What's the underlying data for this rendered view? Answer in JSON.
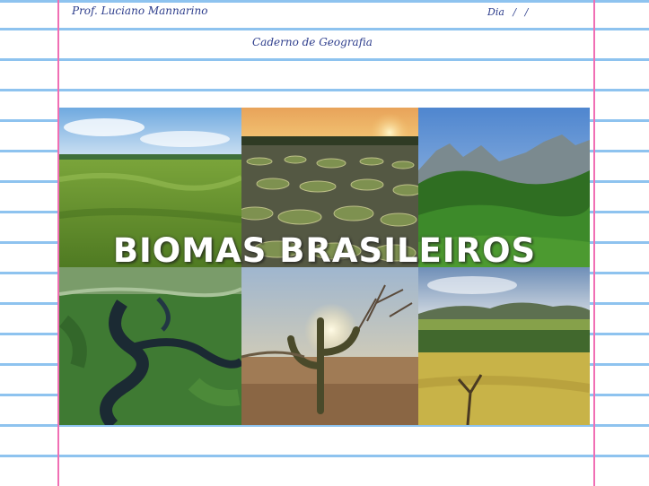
{
  "notebook": {
    "teacher": "Prof. Luciano Mannarino",
    "date_label": "Dia  /  /",
    "subject": "Caderno de Geografia"
  },
  "cover": {
    "title": "BIOMAS BRASILEIROS",
    "tiles": [
      {
        "icon": "pantanal-wetland-photo"
      },
      {
        "icon": "water-lily-sunset-photo"
      },
      {
        "icon": "atlantic-forest-mountains-photo"
      },
      {
        "icon": "amazon-river-aerial-photo"
      },
      {
        "icon": "caatinga-cactus-photo"
      },
      {
        "icon": "cerrado-savanna-photo"
      }
    ]
  },
  "colors": {
    "rule_line": "#8ec3ef",
    "margin_line": "#f06fb4",
    "handwriting": "#2d3d8c"
  }
}
